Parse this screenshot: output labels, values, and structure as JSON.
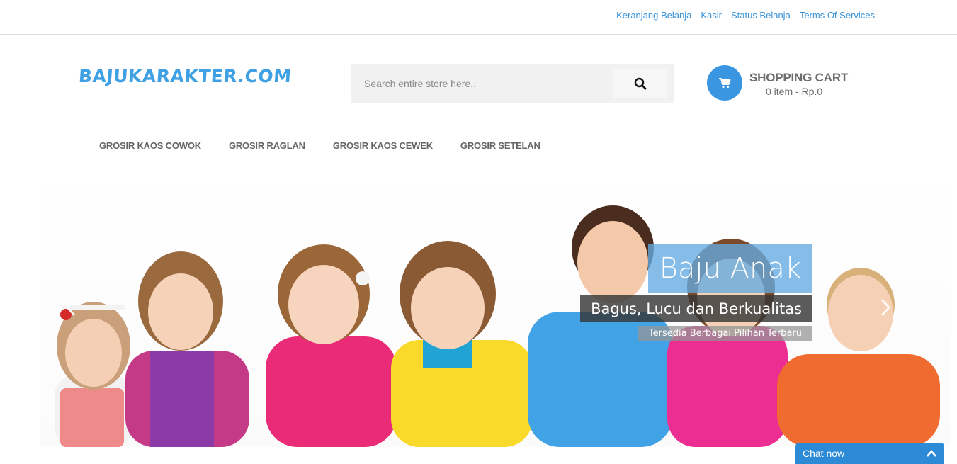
{
  "top_links": [
    "Keranjang Belanja",
    "Kasir",
    "Status Belanja",
    "Terms Of Services"
  ],
  "logo": "BAJUKARAKTER.COM",
  "search": {
    "placeholder": "Search entire store here..",
    "icon": "search-icon"
  },
  "cart": {
    "title": "SHOPPING CART",
    "summary": "0 item - Rp.0",
    "icon": "cart-icon"
  },
  "nav": [
    "GROSIR KAOS COWOK",
    "GROSIR RAGLAN",
    "GROSIR KAOS CEWEK",
    "GROSIR SETELAN"
  ],
  "hero": {
    "title": "Baju Anak",
    "subtitle": "Bagus, Lucu dan Berkualitas",
    "tagline": "Tersedia Berbagai Pilihan Terbaru",
    "prev_icon": "chevron-left-icon",
    "next_icon": "chevron-right-icon"
  },
  "chat": {
    "label": "Chat now",
    "icon": "chevron-up-icon"
  },
  "colors": {
    "accent": "#3a96e0",
    "link": "#3a93d8",
    "logo": "#3fa0e4"
  }
}
